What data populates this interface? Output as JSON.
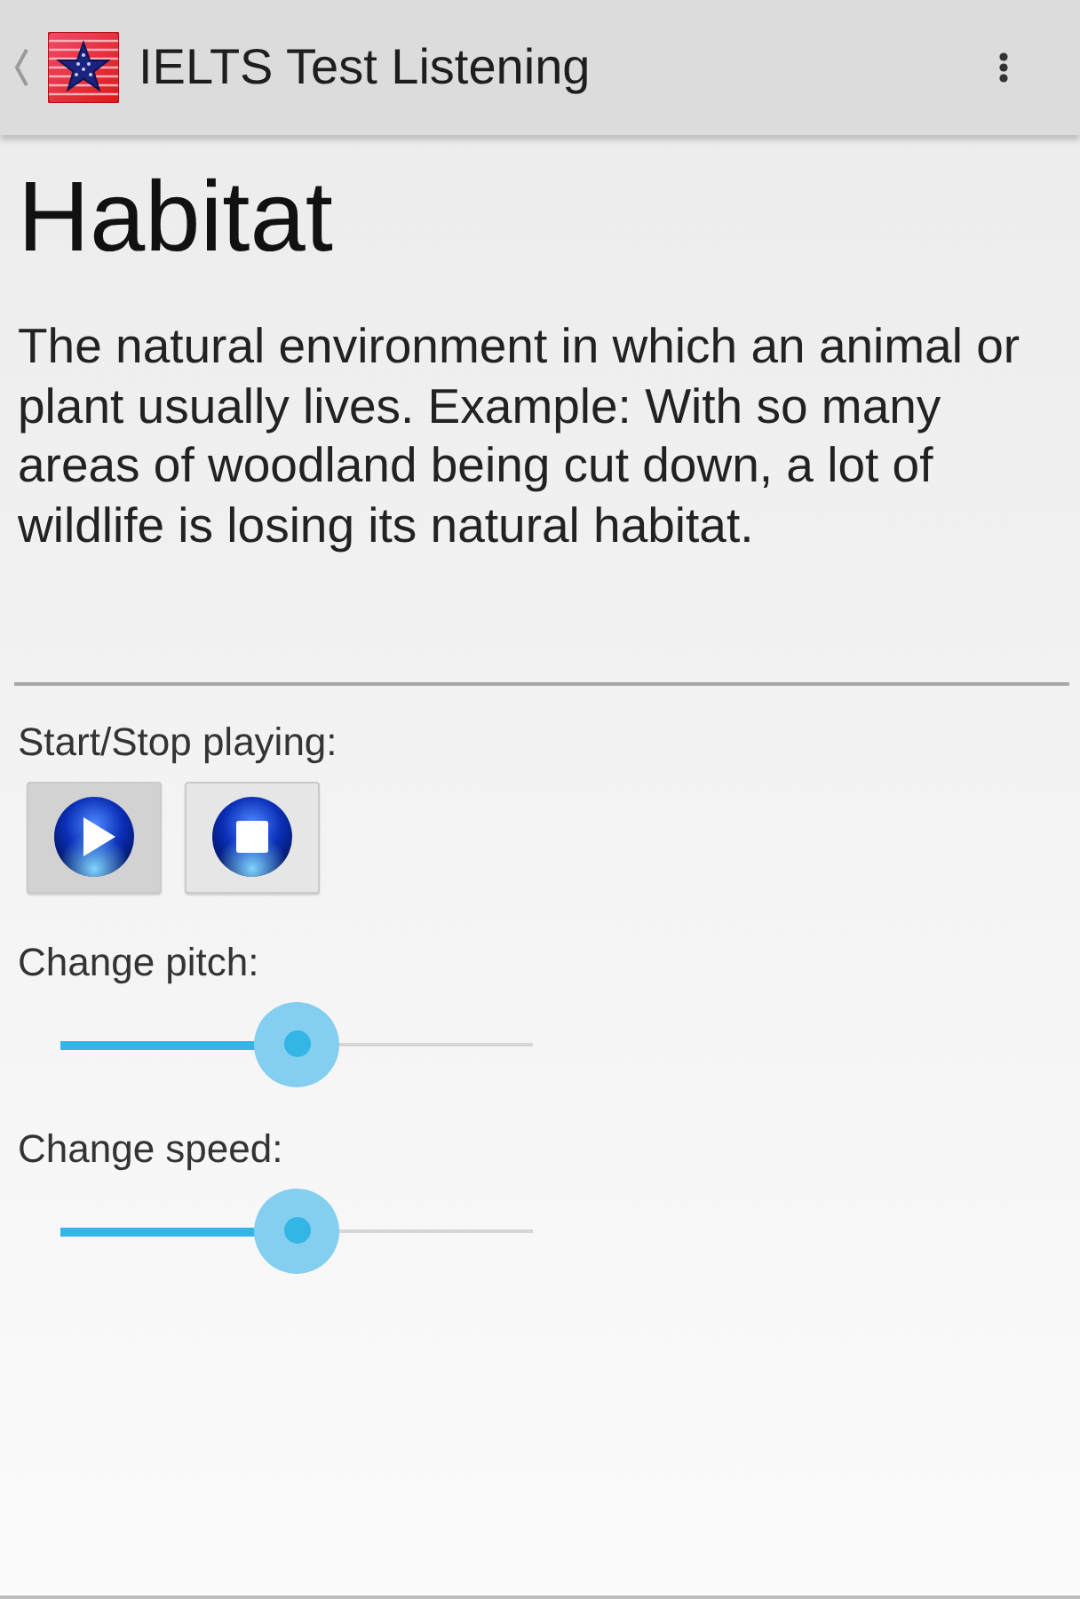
{
  "action_bar": {
    "title": "IELTS Test Listening"
  },
  "word": {
    "title": "Habitat",
    "definition": "The natural environment in which an animal or plant usually lives. Example: With so many areas of woodland being cut down, a lot of wildlife is losing its natural habitat."
  },
  "player": {
    "label": "Start/Stop playing:",
    "buttons": [
      {
        "kind": "play",
        "pressed": true
      },
      {
        "kind": "stop",
        "pressed": false
      }
    ]
  },
  "controls": [
    {
      "label": "Change pitch:",
      "level": 0.5
    },
    {
      "label": "Change speed:",
      "level": 0.5
    }
  ]
}
